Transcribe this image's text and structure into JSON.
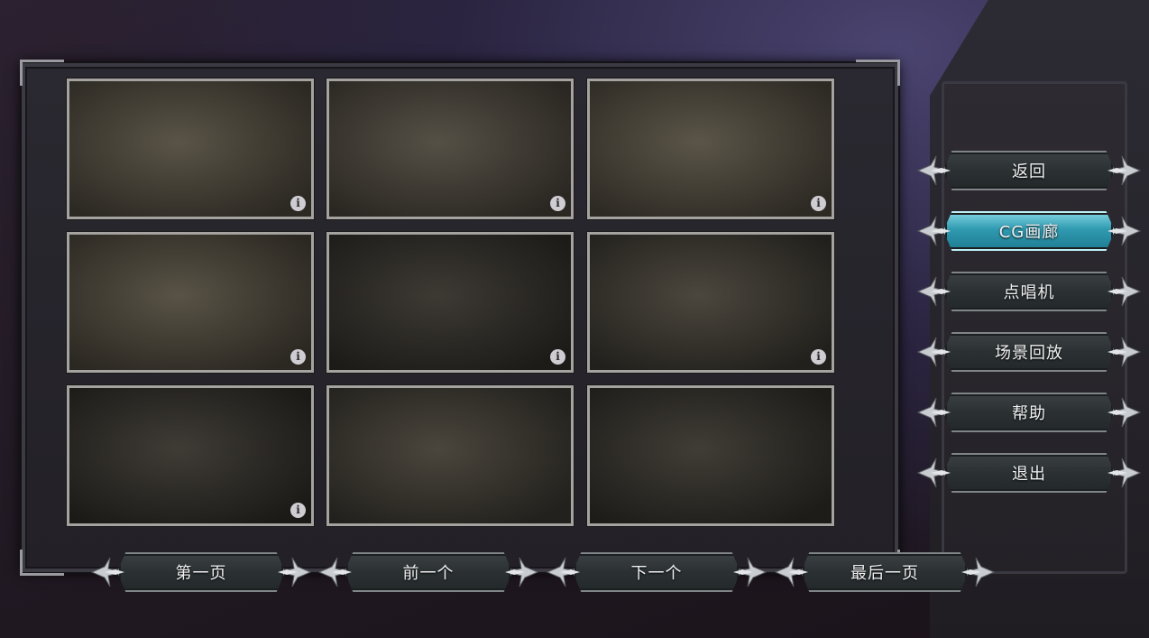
{
  "gallery": {
    "items": [
      {
        "tone": [
          "#5a5447",
          "#2c2923"
        ],
        "info": true
      },
      {
        "tone": [
          "#555046",
          "#2a2722"
        ],
        "info": true
      },
      {
        "tone": [
          "#5b5548",
          "#2d2a24"
        ],
        "info": true
      },
      {
        "tone": [
          "#595346",
          "#2b2822"
        ],
        "info": true
      },
      {
        "tone": [
          "#3d3a34",
          "#1d1b18"
        ],
        "info": true
      },
      {
        "tone": [
          "#4b473e",
          "#22201c"
        ],
        "info": true
      },
      {
        "tone": [
          "#3f3c36",
          "#1c1a17"
        ],
        "info": true
      },
      {
        "tone": [
          "#4a463d",
          "#23211d"
        ],
        "info": false
      },
      {
        "tone": [
          "#403d36",
          "#1e1c19"
        ],
        "info": false
      }
    ]
  },
  "menu": {
    "items": [
      {
        "label": "返回",
        "active": false
      },
      {
        "label": "CG画廊",
        "active": true
      },
      {
        "label": "点唱机",
        "active": false
      },
      {
        "label": "场景回放",
        "active": false
      },
      {
        "label": "帮助",
        "active": false
      },
      {
        "label": "退出",
        "active": false
      }
    ]
  },
  "nav": {
    "first_page": "第一页",
    "previous": "前一个",
    "next": "下一个",
    "last_page": "最后一页"
  },
  "colors": {
    "accent_active": "#2f9ab0",
    "button_dark": "#2b3133",
    "thumb_border": "#a5a39f"
  }
}
